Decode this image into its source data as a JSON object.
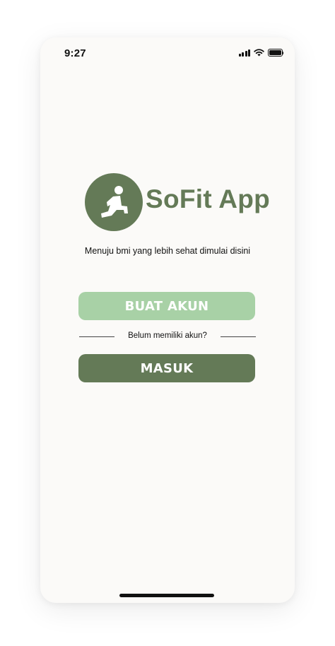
{
  "status_bar": {
    "time": "9:27",
    "icons": [
      "cellular-signal-icon",
      "wifi-icon",
      "battery-icon"
    ]
  },
  "logo": {
    "icon": "running-person-icon",
    "app_name": "SoFit App"
  },
  "tagline": "Menuju bmi yang lebih sehat dimulai disini",
  "buttons": {
    "register_label": "BUAT AKUN",
    "login_label": "MASUK"
  },
  "divider_text": "Belum memiliki akun?",
  "colors": {
    "primary": "#647a57",
    "secondary": "#a8d1a6",
    "background": "#fbfaf8"
  }
}
